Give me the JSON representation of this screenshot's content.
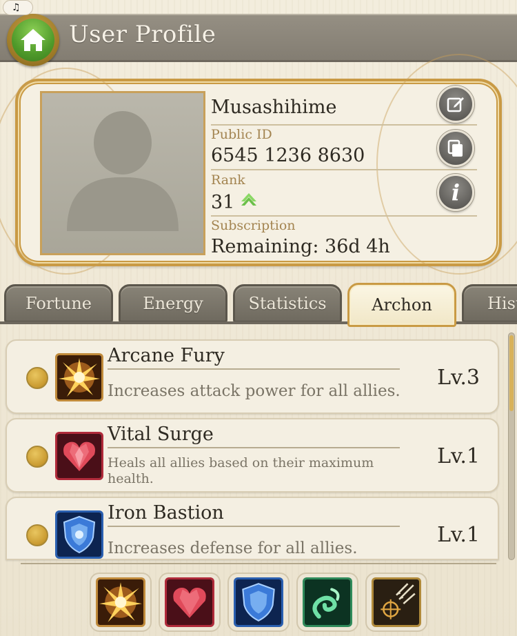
{
  "header": {
    "music_icon": "♫",
    "title": "User Profile"
  },
  "profile": {
    "name": "Musashihime",
    "public_id_label": "Public ID",
    "public_id": "6545 1236 8630",
    "rank_label": "Rank",
    "rank": "31",
    "subscription_label": "Subscription",
    "subscription_value": "Remaining: 36d 4h",
    "info_glyph": "i"
  },
  "tabs": [
    {
      "label": "Fortune",
      "active": false
    },
    {
      "label": "Energy",
      "active": false
    },
    {
      "label": "Statistics",
      "active": false
    },
    {
      "label": "Archon",
      "active": true
    },
    {
      "label": "Hist",
      "active": false
    }
  ],
  "skills": [
    {
      "name": "Arcane Fury",
      "description": "Increases attack power for all allies.",
      "level": "Lv.3",
      "icon": "starburst-icon"
    },
    {
      "name": "Vital Surge",
      "description_line1": "Heals all allies based on their maximum",
      "description_line2": "health.",
      "level": "Lv.1",
      "icon": "heart-crystal-icon"
    },
    {
      "name": "Iron Bastion",
      "description": "Increases defense for all allies.",
      "level": "Lv.1",
      "icon": "shield-icon"
    }
  ],
  "equipped": [
    {
      "icon": "starburst-icon"
    },
    {
      "icon": "heart-crystal-icon"
    },
    {
      "icon": "shield-icon"
    },
    {
      "icon": "green-swirl-icon"
    },
    {
      "icon": "crosshair-arrows-icon"
    }
  ],
  "colors": {
    "header_bar": "#8c867a",
    "gold_accent": "#c99a44",
    "home_green": "#4f9a2a",
    "rank_arrow": "#6cc04a"
  }
}
